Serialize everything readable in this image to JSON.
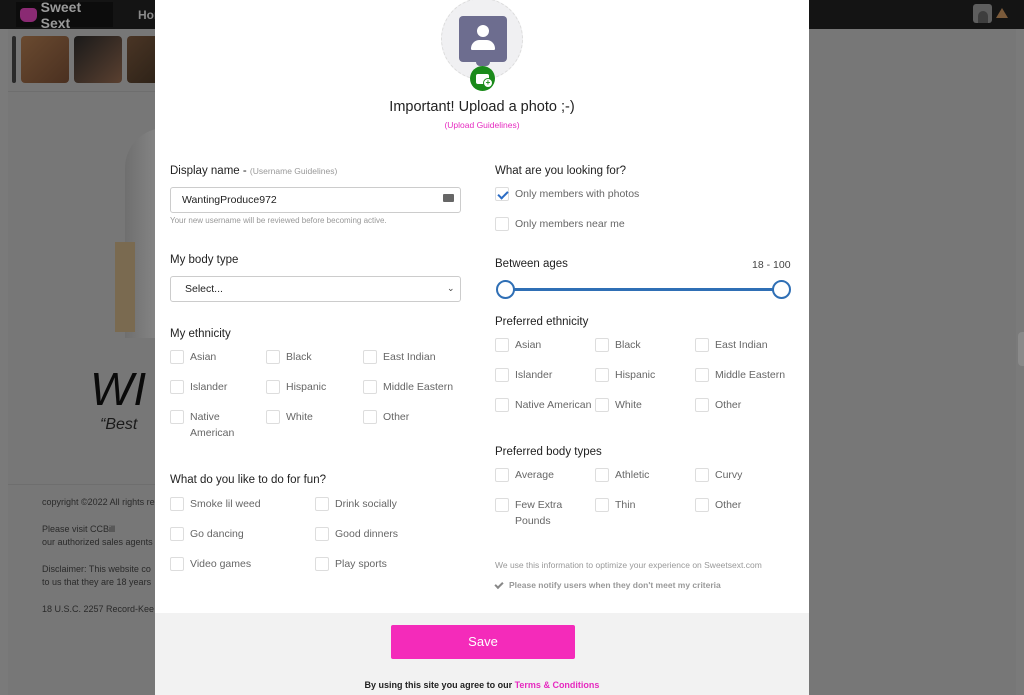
{
  "background": {
    "logo_text": "Sweet Sext",
    "nav_home": "Hom",
    "hero_text": "WI",
    "hero_subtext": "“Best",
    "footer_lines": [
      "copyright ©2022 All rights re",
      "Please visit CCBill",
      "our authorized sales agents",
      "Disclaimer: This website co",
      "to us that they are 18 years",
      "18 U.S.C. 2257 Record-Kee"
    ]
  },
  "modal": {
    "upload_title": "Important! Upload a photo ;-)",
    "upload_guidelines": "(Upload Guidelines)",
    "display_name": {
      "label": "Display name -",
      "sub_label": "(Username Guidelines)",
      "value": "WantingProduce972",
      "help": "Your new username will be reviewed before becoming active."
    },
    "body_type": {
      "label": "My body type",
      "selected": "Select..."
    },
    "ethnicity": {
      "label": "My ethnicity",
      "options": [
        {
          "label": "Asian",
          "checked": false
        },
        {
          "label": "Black",
          "checked": false
        },
        {
          "label": "East Indian",
          "checked": false
        },
        {
          "label": "Islander",
          "checked": false
        },
        {
          "label": "Hispanic",
          "checked": false
        },
        {
          "label": "Middle Eastern",
          "checked": false
        },
        {
          "label": "Native American",
          "checked": false
        },
        {
          "label": "White",
          "checked": false
        },
        {
          "label": "Other",
          "checked": false
        }
      ]
    },
    "fun": {
      "label": "What do you like to do for fun?",
      "options": [
        {
          "label": "Smoke lil weed",
          "checked": false
        },
        {
          "label": "Drink socially",
          "checked": false
        },
        {
          "label": "Go dancing",
          "checked": false
        },
        {
          "label": "Good dinners",
          "checked": false
        },
        {
          "label": "Video games",
          "checked": false
        },
        {
          "label": "Play sports",
          "checked": false
        }
      ]
    },
    "looking_for": {
      "label": "What are you looking for?",
      "options": [
        {
          "label": "Only members with photos",
          "checked": true
        },
        {
          "label": "Only members near me",
          "checked": false
        }
      ]
    },
    "ages": {
      "label": "Between ages",
      "range_text": "18 - 100",
      "min": 18,
      "max": 100
    },
    "preferred_ethnicity": {
      "label": "Preferred ethnicity",
      "options": [
        {
          "label": "Asian",
          "checked": false
        },
        {
          "label": "Black",
          "checked": false
        },
        {
          "label": "East Indian",
          "checked": false
        },
        {
          "label": "Islander",
          "checked": false
        },
        {
          "label": "Hispanic",
          "checked": false
        },
        {
          "label": "Middle Eastern",
          "checked": false
        },
        {
          "label": "Native American",
          "checked": false
        },
        {
          "label": "White",
          "checked": false
        },
        {
          "label": "Other",
          "checked": false
        }
      ]
    },
    "preferred_body": {
      "label": "Preferred body types",
      "options": [
        {
          "label": "Average",
          "checked": false
        },
        {
          "label": "Athletic",
          "checked": false
        },
        {
          "label": "Curvy",
          "checked": false
        },
        {
          "label": "Few Extra Pounds",
          "checked": false
        },
        {
          "label": "Thin",
          "checked": false
        },
        {
          "label": "Other",
          "checked": false
        }
      ]
    },
    "info_text": "We use this information to optimize your experience on Sweetsext.com",
    "notify_text": "Please notify users when they don't meet my criteria",
    "save_label": "Save",
    "terms_prefix": "By using this site you agree to our",
    "terms_link": "Terms & Conditions"
  },
  "colors": {
    "accent_pink": "#f42bba",
    "slider_blue": "#2f6fb5",
    "camera_green": "#1a8a1a"
  }
}
